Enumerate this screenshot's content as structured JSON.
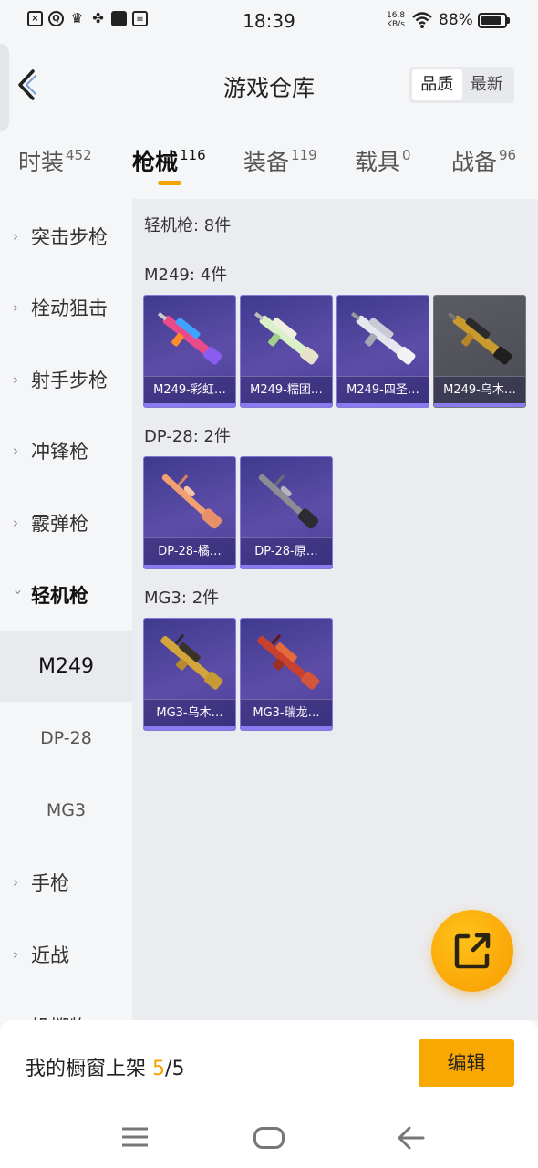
{
  "status_bar": {
    "time": "18:39",
    "net_speed_value": "16.8",
    "net_speed_unit": "KB/s",
    "battery": "88%",
    "battery_level": 0.88,
    "icons": [
      "x-doc-icon",
      "q-icon",
      "crown-icon",
      "pinwheel-icon",
      "square-app-icon",
      "wallet-icon",
      "wifi-icon",
      "battery-icon"
    ]
  },
  "header": {
    "title": "游戏仓库",
    "sort_options": [
      "品质",
      "最新"
    ],
    "active_sort": "品质"
  },
  "tabs": [
    {
      "label": "时装",
      "count": "452"
    },
    {
      "label": "枪械",
      "count": "116"
    },
    {
      "label": "装备",
      "count": "119"
    },
    {
      "label": "载具",
      "count": "0"
    },
    {
      "label": "战备",
      "count": "96"
    }
  ],
  "active_tab": "枪械",
  "sidebar": {
    "items": [
      {
        "label": "突击步枪"
      },
      {
        "label": "栓动狙击"
      },
      {
        "label": "射手步枪"
      },
      {
        "label": "冲锋枪"
      },
      {
        "label": "霰弹枪"
      },
      {
        "label": "轻机枪"
      },
      {
        "label": "M249"
      },
      {
        "label": "DP-28"
      },
      {
        "label": "MG3"
      },
      {
        "label": "手枪"
      },
      {
        "label": "近战"
      },
      {
        "label": "投掷物"
      }
    ],
    "expanded": "轻机枪",
    "active": "M249"
  },
  "content": {
    "category_total": "轻机枪: 8件",
    "groups": [
      {
        "title": "M249: 4件",
        "items": [
          {
            "name": "M249-彩虹…",
            "rarity_color": "#4a3f97"
          },
          {
            "name": "M249-糯团…",
            "rarity_color": "#4a3f97"
          },
          {
            "name": "M249-四圣…",
            "rarity_color": "#4a3f97"
          },
          {
            "name": "M249-乌木…",
            "rarity_color": "#4f5057"
          }
        ]
      },
      {
        "title": "DP-28: 2件",
        "items": [
          {
            "name": "DP-28-橘…",
            "rarity_color": "#4a3f97"
          },
          {
            "name": "DP-28-原…",
            "rarity_color": "#4a3f97"
          }
        ]
      },
      {
        "title": "MG3: 2件",
        "items": [
          {
            "name": "MG3-乌木…",
            "rarity_color": "#4a3f97"
          },
          {
            "name": "MG3-瑞龙…",
            "rarity_color": "#4a3f97"
          }
        ]
      }
    ]
  },
  "showcase": {
    "label": "我的橱窗上架",
    "current": "5",
    "separator": "/",
    "max": "5",
    "edit_label": "编辑"
  },
  "colors": {
    "accent": "#f5a300",
    "card_purple": "#4a3f97",
    "fab": "#ffb400"
  },
  "nav": {
    "icons": [
      "menu-icon",
      "home-icon",
      "back-icon"
    ]
  }
}
